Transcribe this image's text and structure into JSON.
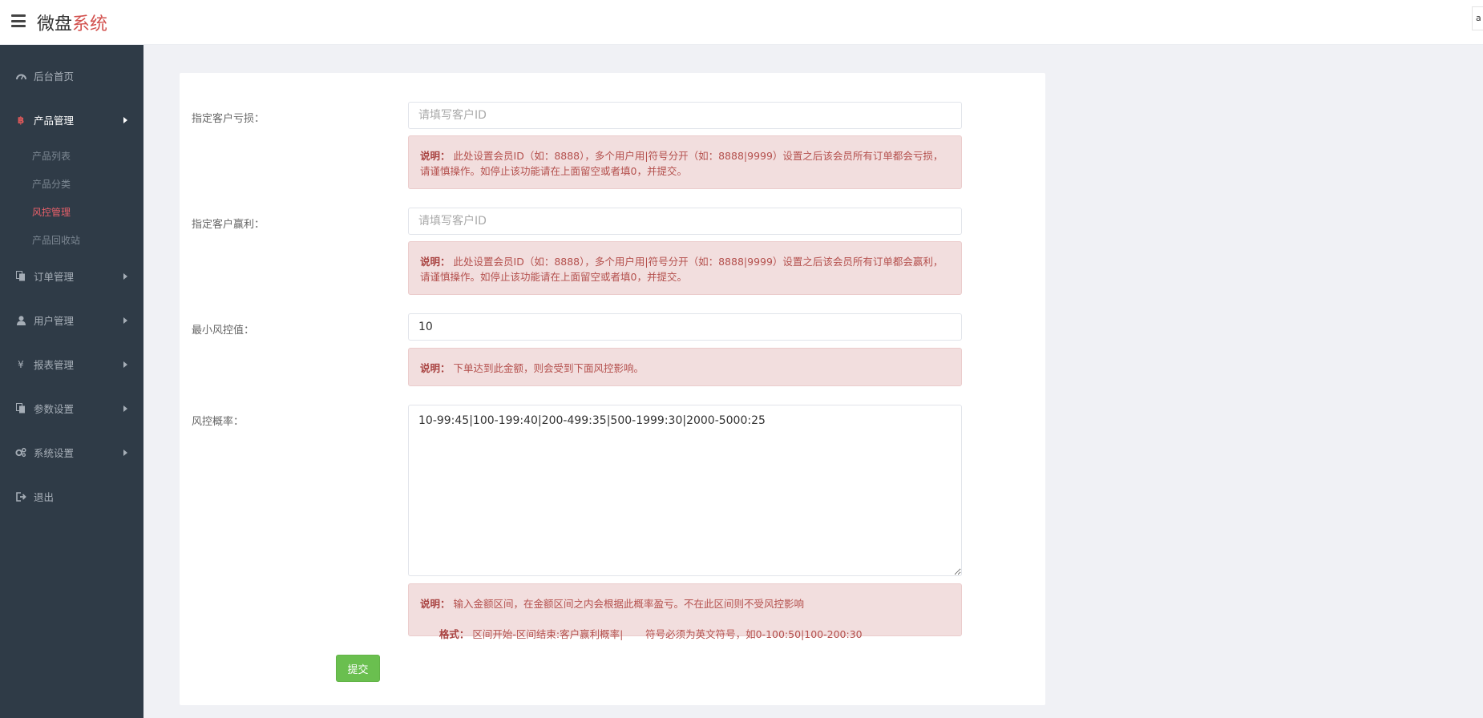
{
  "header": {
    "brand_main": "微盘",
    "brand_accent": "系统",
    "top_right_text": "a"
  },
  "sidebar": {
    "items": [
      {
        "label": "后台首页",
        "icon": "dashboard-icon"
      },
      {
        "label": "产品管理",
        "icon": "bitcoin-icon",
        "active": true
      },
      {
        "label": "订单管理",
        "icon": "copy-icon"
      },
      {
        "label": "用户管理",
        "icon": "user-icon"
      },
      {
        "label": "报表管理",
        "icon": "yen-icon"
      },
      {
        "label": "参数设置",
        "icon": "copy-icon"
      },
      {
        "label": "系统设置",
        "icon": "gears-icon"
      },
      {
        "label": "退出",
        "icon": "sign-out-icon"
      }
    ],
    "sub_items": [
      {
        "label": "产品列表"
      },
      {
        "label": "产品分类"
      },
      {
        "label": "风控管理",
        "active": true
      },
      {
        "label": "产品回收站"
      }
    ]
  },
  "form": {
    "loss": {
      "label": "指定客户亏损：",
      "placeholder": "请填写客户ID",
      "value": "",
      "note_title": "说明：",
      "note_text": "此处设置会员ID（如：8888），多个用户用|符号分开（如：8888|9999）设置之后该会员所有订单都会亏损，请谨慎操作。如停止该功能请在上面留空或者填0，并提交。"
    },
    "profit": {
      "label": "指定客户赢利：",
      "placeholder": "请填写客户ID",
      "value": "",
      "note_title": "说明：",
      "note_text": "此处设置会员ID（如：8888），多个用户用|符号分开（如：8888|9999）设置之后该会员所有订单都会赢利，请谨慎操作。如停止该功能请在上面留空或者填0，并提交。"
    },
    "min_value": {
      "label": "最小风控值：",
      "value": "10",
      "note_title": "说明：",
      "note_text": "下单达到此金额，则会受到下面风控影响。"
    },
    "probability": {
      "label": "风控概率：",
      "value": "10-99:45|100-199:40|200-499:35|500-1999:30|2000-5000:25",
      "note_title": "说明：",
      "note_text": "输入金额区间，在金额区间之内会根据此概率盈亏。不在此区间则不受风控影响",
      "format_title": "格式：",
      "format_text": "区间开始-区间结束:客户赢利概率|       符号必须为英文符号，如0-100:50|100-200:30"
    },
    "submit_label": "提交"
  },
  "colors": {
    "sidebar_bg": "#2f3b47",
    "accent_red": "#d2504d",
    "note_bg": "#f2dede",
    "note_text": "#b4504d",
    "submit_green": "#6abf4f"
  }
}
